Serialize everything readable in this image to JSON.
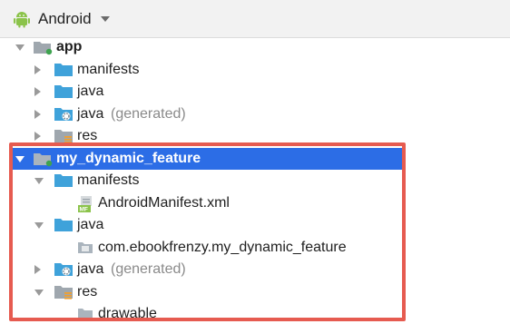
{
  "toolbar": {
    "view_label": "Android",
    "icons": {
      "view": "android-robot-icon",
      "dropdown": "chevron-down-icon"
    }
  },
  "tree": {
    "app": "app",
    "manifests_1": "manifests",
    "java_1": "java",
    "java_gen_1": "java",
    "java_gen_suffix_1": "(generated)",
    "res_1": "res",
    "feature": "my_dynamic_feature",
    "manifests_2": "manifests",
    "manifest_file": "AndroidManifest.xml",
    "manifest_file_badge": "MF",
    "java_2": "java",
    "package": "com.ebookfrenzy.my_dynamic_feature",
    "java_gen_2": "java",
    "java_gen_suffix_2": "(generated)",
    "res_2": "res",
    "drawable": "drawable"
  },
  "colors": {
    "selection": "#2c6de6",
    "highlight_box": "#e65b50",
    "folder_blue": "#3fa2da",
    "module_gray": "#9fa7ae",
    "module_dot": "#3ea34f",
    "android_green": "#8bc34a"
  },
  "selected_item": "my_dynamic_feature"
}
